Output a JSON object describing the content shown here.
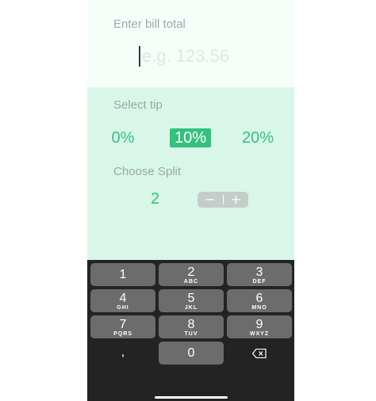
{
  "bill": {
    "label": "Enter bill total",
    "placeholder": "e.g. 123.56",
    "value": ""
  },
  "tip": {
    "label": "Select tip",
    "options": [
      "0%",
      "10%",
      "20%"
    ],
    "selected": "10%"
  },
  "split": {
    "label": "Choose Split",
    "value": "2",
    "decrement": "−",
    "increment": "+"
  },
  "keypad": {
    "keys": [
      {
        "digit": "1",
        "letters": ""
      },
      {
        "digit": "2",
        "letters": "ABC"
      },
      {
        "digit": "3",
        "letters": "DEF"
      },
      {
        "digit": "4",
        "letters": "GHI"
      },
      {
        "digit": "5",
        "letters": "JKL"
      },
      {
        "digit": "6",
        "letters": "MNO"
      },
      {
        "digit": "7",
        "letters": "PQRS"
      },
      {
        "digit": "8",
        "letters": "TUV"
      },
      {
        "digit": "9",
        "letters": "WXYZ"
      },
      {
        "digit": "0",
        "letters": ""
      }
    ],
    "comma": ",",
    "backspace_icon": "backspace-icon"
  },
  "colors": {
    "accent": "#32c27e",
    "tip_background": "#d9f7e8",
    "keyboard_background": "#232323",
    "key_background": "#6c6c6c"
  }
}
